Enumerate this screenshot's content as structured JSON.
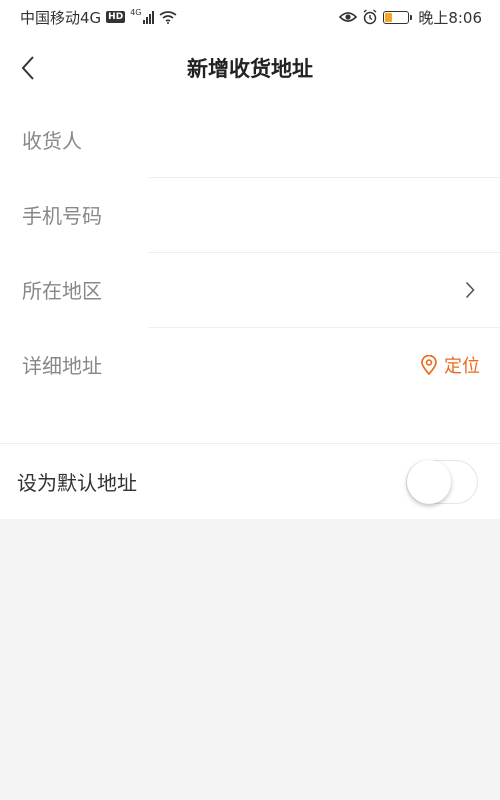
{
  "status_bar": {
    "carrier": "中国移动4G",
    "hd": "HD",
    "network": "4G",
    "time": "晚上8:06",
    "battery_level": 0.3
  },
  "header": {
    "title": "新增收货地址"
  },
  "form": {
    "consignee_label": "收货人",
    "phone_label": "手机号码",
    "region_label": "所在地区",
    "address_label": "详细地址",
    "locate_label": "定位"
  },
  "default_address": {
    "label": "设为默认地址",
    "enabled": false
  },
  "colors": {
    "accent": "#ee6a1c",
    "background": "#f4f4f4"
  },
  "icons": [
    "back-arrow-icon",
    "chevron-right-icon",
    "location-pin-icon",
    "eye-icon",
    "alarm-icon",
    "wifi-icon",
    "signal-icon",
    "battery-icon"
  ]
}
